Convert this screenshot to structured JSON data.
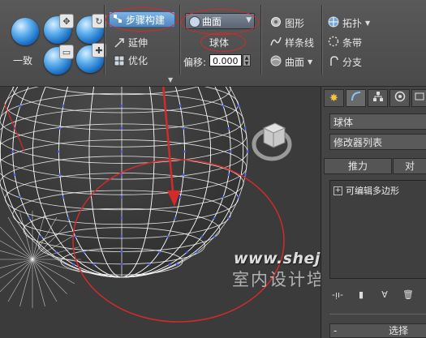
{
  "ribbon": {
    "uniform_label": "一致",
    "step_build_label": "步骤构建",
    "extend_label": "延伸",
    "optimize_label": "优化",
    "surface_combo_value": "曲面",
    "sphere_label": "球体",
    "offset_label": "偏移:",
    "offset_value": "0.000",
    "shape_label": "图形",
    "spline_label": "样条线",
    "surface_menu_label": "曲面",
    "topology_label": "拓扑",
    "strip_label": "条带",
    "branch_label": "分支"
  },
  "viewport": {
    "watermark_url": "www.shejiedu.com",
    "watermark_text": "室内设计培训"
  },
  "panel": {
    "object_name": "球体",
    "modifier_list_label": "修改器列表",
    "push_label": "推力",
    "pull_label": "对",
    "stack_item": "可编辑多边形",
    "selection_rollout": "选择"
  },
  "colors": {
    "annotation_red": "#d42a2a",
    "wire": "#ffffff",
    "vertex_blue": "#4a5bff",
    "button_blue": "#5f95cc"
  }
}
